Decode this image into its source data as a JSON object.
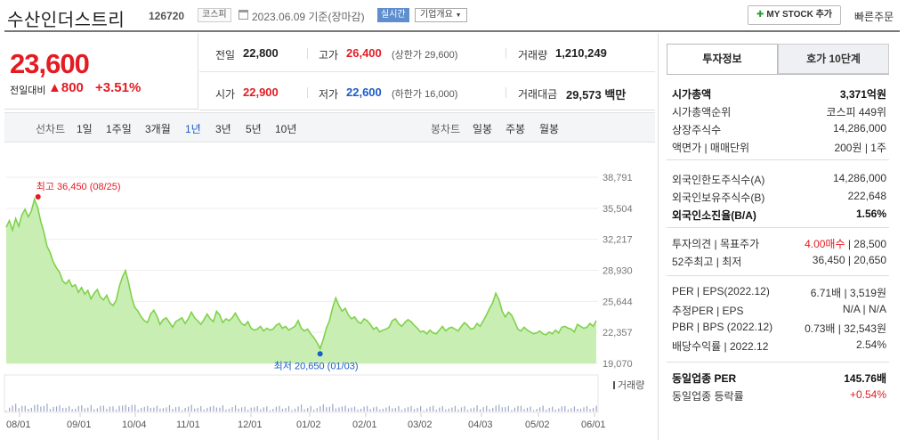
{
  "header": {
    "title": "수산인더스트리",
    "code": "126720",
    "market_badge": "코스피",
    "date_text": "2023.06.09 기준(장마감)",
    "realtime_label": "실시간",
    "corp_info_label": "기업개요",
    "mystock_label": "MY STOCK 추가",
    "quick_order_label": "빠른주문"
  },
  "price": {
    "current": "23,600",
    "change_label": "전일대비",
    "change_arrow": "▲",
    "change_value": "800",
    "change_pct": "+3.51%"
  },
  "grid": {
    "prev_close_label": "전일",
    "prev_close": "22,800",
    "high_label": "고가",
    "high": "26,400",
    "upper_limit": "(상한가 29,600)",
    "volume_label": "거래량",
    "volume": "1,210,249",
    "open_label": "시가",
    "open": "22,900",
    "low_label": "저가",
    "low": "22,600",
    "lower_limit": "(하한가 16,000)",
    "amount_label": "거래대금",
    "amount": "29,573",
    "amount_unit": "백만"
  },
  "periods": {
    "line_label": "선차트",
    "items": [
      "1일",
      "1주일",
      "3개월",
      "1년",
      "3년",
      "5년",
      "10년"
    ],
    "active": "1년",
    "candle_label": "봉차트",
    "candle_items": [
      "일봉",
      "주봉",
      "월봉"
    ]
  },
  "chart_data": {
    "type": "line",
    "ylabels": [
      "38,791",
      "35,504",
      "32,217",
      "28,930",
      "25,644",
      "22,357",
      "19,070"
    ],
    "ylim": [
      19070,
      38791
    ],
    "xlabels": [
      "08/01",
      "09/01",
      "10/04",
      "11/01",
      "12/01",
      "01/02",
      "02/01",
      "03/02",
      "04/03",
      "05/02",
      "06/01"
    ],
    "high_annotation": "최고 36,450 (08/25)",
    "low_annotation": "최저 20,650 (01/03)",
    "volume_label": "거래량",
    "series": [
      {
        "values": [
          33500,
          34200,
          33200,
          34400,
          33600,
          34800,
          35400,
          34600,
          35200,
          36450,
          35600,
          34100,
          33000,
          31500,
          30800,
          29800,
          29200,
          28700,
          27800,
          27500,
          27900,
          27200,
          27400,
          26600,
          27100,
          26400,
          26800,
          25900,
          26500,
          26900,
          26100,
          25800,
          26300,
          25500,
          25200,
          25700,
          27200,
          28200,
          28900,
          27600,
          26000,
          25000,
          24600,
          24000,
          23600,
          23400,
          24300,
          24700,
          24100,
          23200,
          23700,
          23900,
          23400,
          22900,
          23500,
          23700,
          23900,
          23300,
          23800,
          24500,
          23900,
          23600,
          23200,
          23700,
          24300,
          23800,
          23500,
          24600,
          24200,
          23400,
          23800,
          23600,
          23900,
          24400,
          23800,
          23300,
          23100,
          23500,
          22800,
          22600,
          22700,
          23000,
          22500,
          22800,
          22600,
          22700,
          23100,
          23300,
          22800,
          23000,
          22600,
          22800,
          23000,
          23600,
          22800,
          22500,
          22700,
          22200,
          21800,
          21300,
          20650,
          21600,
          22800,
          23600,
          25000,
          26000,
          25200,
          24600,
          24900,
          24200,
          23800,
          24000,
          23500,
          23300,
          23800,
          23600,
          23200,
          22700,
          22900,
          22400,
          22600,
          22700,
          22900,
          23600,
          23800,
          23300,
          23000,
          23400,
          23700,
          23500,
          23100,
          22800,
          22400,
          22500,
          22200,
          22600,
          22300,
          22200,
          22600,
          23000,
          22500,
          22800,
          22900,
          22700,
          22500,
          23000,
          23400,
          23100,
          22700,
          22800,
          23300,
          23000,
          23600,
          24200,
          24900,
          25500,
          26500,
          25800,
          24600,
          24000,
          24500,
          24200,
          23500,
          22700,
          22500,
          22900,
          22600,
          22400,
          22200,
          22300,
          22500,
          22200,
          22100,
          22400,
          22200,
          22600,
          22300,
          22900,
          23000,
          22800,
          22700,
          22400,
          23200,
          23000,
          22800,
          22900,
          23300,
          23000,
          23600
        ]
      }
    ]
  },
  "right_panel": {
    "tab_active": "투자정보",
    "tab_other": "호가 10단계",
    "rows1": [
      {
        "label": "시가총액",
        "value": "3,371억원",
        "bold": true
      },
      {
        "label": "시가총액순위",
        "value": "코스피 449위"
      },
      {
        "label": "상장주식수",
        "value": "14,286,000"
      },
      {
        "label": "액면가 | 매매단위",
        "value": "200원 | 1주"
      }
    ],
    "rows2": [
      {
        "label": "외국인한도주식수(A)",
        "value": "14,286,000"
      },
      {
        "label": "외국인보유주식수(B)",
        "value": "222,648"
      },
      {
        "label": "외국인소진율(B/A)",
        "value": "1.56%",
        "bold": true
      }
    ],
    "rows3": [
      {
        "label": "투자의견 | 목표주가",
        "value_red": "4.00매수",
        "value": "| 28,500"
      },
      {
        "label": "52주최고 | 최저",
        "value": "36,450 | 20,650"
      }
    ],
    "rows4": [
      {
        "label": "PER | EPS(2022.12)",
        "value": "6.71배 | 3,519원"
      },
      {
        "label": "추정PER | EPS",
        "value": "N/A | N/A"
      },
      {
        "label": "PBR | BPS (2022.12)",
        "value": "0.73배 | 32,543원"
      },
      {
        "label": "배당수익률 | 2022.12",
        "value": "2.54%"
      }
    ],
    "rows5": [
      {
        "label": "동일업종 PER",
        "value": "145.76배",
        "bold": true
      },
      {
        "label": "동일업종 등락률",
        "value": "+0.54%",
        "red": true
      }
    ]
  }
}
